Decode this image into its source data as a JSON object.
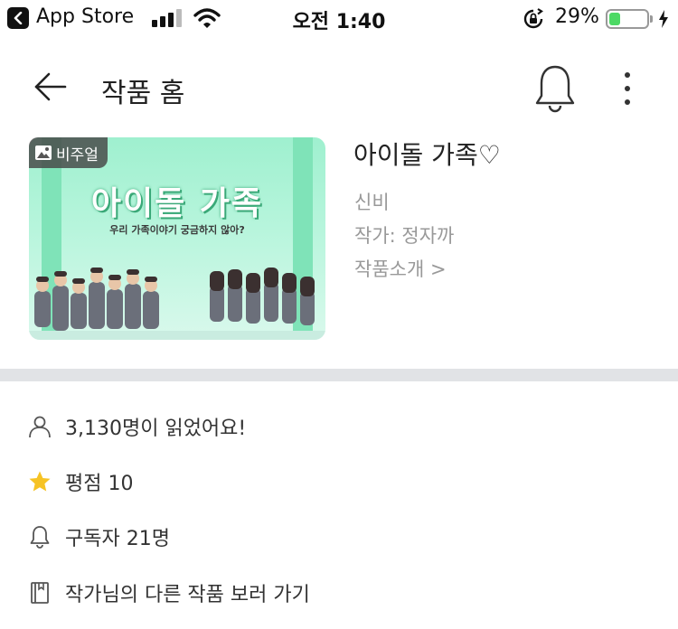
{
  "status_bar": {
    "back_app": "App Store",
    "time": "오전 1:40",
    "battery_percent": "29%",
    "battery_level": 0.29,
    "signal_bars": 3
  },
  "header": {
    "title": "작품 홈",
    "icons": [
      "back-arrow-icon",
      "bell-icon",
      "more-vertical-icon"
    ]
  },
  "work": {
    "badge": "비주얼",
    "cover_title": "아이돌 가족",
    "cover_subtitle": "우리 가족이야기 궁금하지 않아?",
    "title": "아이돌 가족♡",
    "genre": "신비",
    "author": "작가: 정자까",
    "intro_link": "작품소개 >"
  },
  "stats": [
    {
      "icon": "user-icon",
      "text": "3,130명이 읽었어요!"
    },
    {
      "icon": "star-icon",
      "text": "평점 10"
    },
    {
      "icon": "bell-icon",
      "text": "구독자 21명"
    },
    {
      "icon": "book-icon",
      "text": "작가님의 다른 작품 보러 가기"
    }
  ],
  "colors": {
    "battery_fill": "#4cd964",
    "star": "#f6c325",
    "divider": "#e1e3e6",
    "cover_bg": "#9ff0cf"
  }
}
